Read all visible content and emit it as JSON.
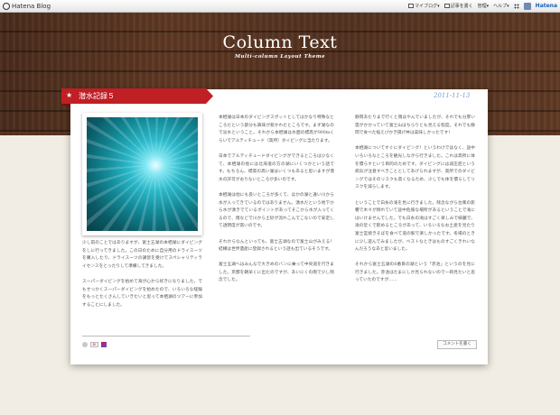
{
  "toolbar": {
    "brand": "Hatena Blog",
    "my_blog": "マイブログ",
    "write": "記事を書く",
    "manage": "管理",
    "help": "ヘルプ",
    "hatena": "Hatena"
  },
  "blog": {
    "title": "Column Text",
    "subtitle": "Multi-column Layout Theme"
  },
  "entry": {
    "title": "潜水記録５",
    "date": "2011-11-13",
    "col1": [
      "少し前のことではありますが、富士五湖の本栖湖にダイビングをしに行ってきました。この日のために自分用のドライスーツを購入したり、ドライスーツの講習を受けてスペシャリティライセンスをとったりして準備してきました。",
      "スーパーダイビングを始めて海が心から好きになりました。でもせっかくスーパーダイビングを始めたので、いろいろな経験をもっとたくさんしていきたいと思って本栖湖のツアーに参加することにしました。"
    ],
    "col2": [
      "本栖湖は日本のダイビングスポットとしてはかなり特殊なところだという部分も興味が惹かれたところです。まず湖なので淡水ということ。それから本栖湖は水面の標高が900mくらいでアルティチュード（高所）ダイビングに当たります。",
      "日本でアルティチュードダイビングができるところは少なくて、本栖湖の他には北海道の方の湖にいくつかという話です。もちろん、標高の高い湖はいくつもあると思いますが潜水の許可がおりないところが多いのです。",
      "本栖湖は他にも良いところが多くて、ほかの湖と違い川から水が入ってきているのではありません。湧水だという地下から水が湧きでているポイントがあってそこから水が入ってくるので、雨などで川から土砂が流れこんでこないので安定して透明度が高いのです。",
      "それからなんといっても、富士五湖なので富士山がみえる！　結構は世界遺産に登録されるという話も出ているそうです。",
      "富士五湖へはみんなで大きめのバンに乗って中央道を行きました。京都を朝早くに出たのですが、あいにくの雨で少し残念でした。"
    ],
    "col3": [
      "静岡あたりまで行くと雨はやんでいましたが、それでも分厚い雲がかかっていて富士山はちらりとも見える程度。それでも静岡で食べた桜えびかき揚げ丼は美味しかったです！",
      "本栖湖についてすぐにダイビング！というわけではなく、途中いろいろなところを観光しながら行きました。これは高所に体を慣らすという目的のためです。ダイビングには減圧症という病気が注意すべきこととしてあげられますが、高所でのダイビングではそのリスクも高くなるため、少しでも体を慣らしてリスクを減らします。",
      "ということで白糸の滝を見に行きました。残念ながら台風の影響で木々が倒れていて途中危険な場所があるということで滝にはいけませんでした。でも白糸の滝はすごく楽しみで綺麗で、滝の近くで飲めるところがあって、いろいろなお土産を見たり富士宮焼きそばを食べて道の駅で楽しかったです。冬場のときに少し遊んでみましたが、ベストなときはものすごくきれいなんだろうなあと思いました。",
      "それから富士五湖の6番目の湖という「赤池」というのを見に行きました。赤池はたまにしか見られないので一目見たいと思っていたのですが……"
    ],
    "comment_label": "コメントを書く"
  },
  "colors": {
    "ribbon": "#c01f24",
    "date": "#7b9ec9",
    "wood": "#5a3522"
  }
}
